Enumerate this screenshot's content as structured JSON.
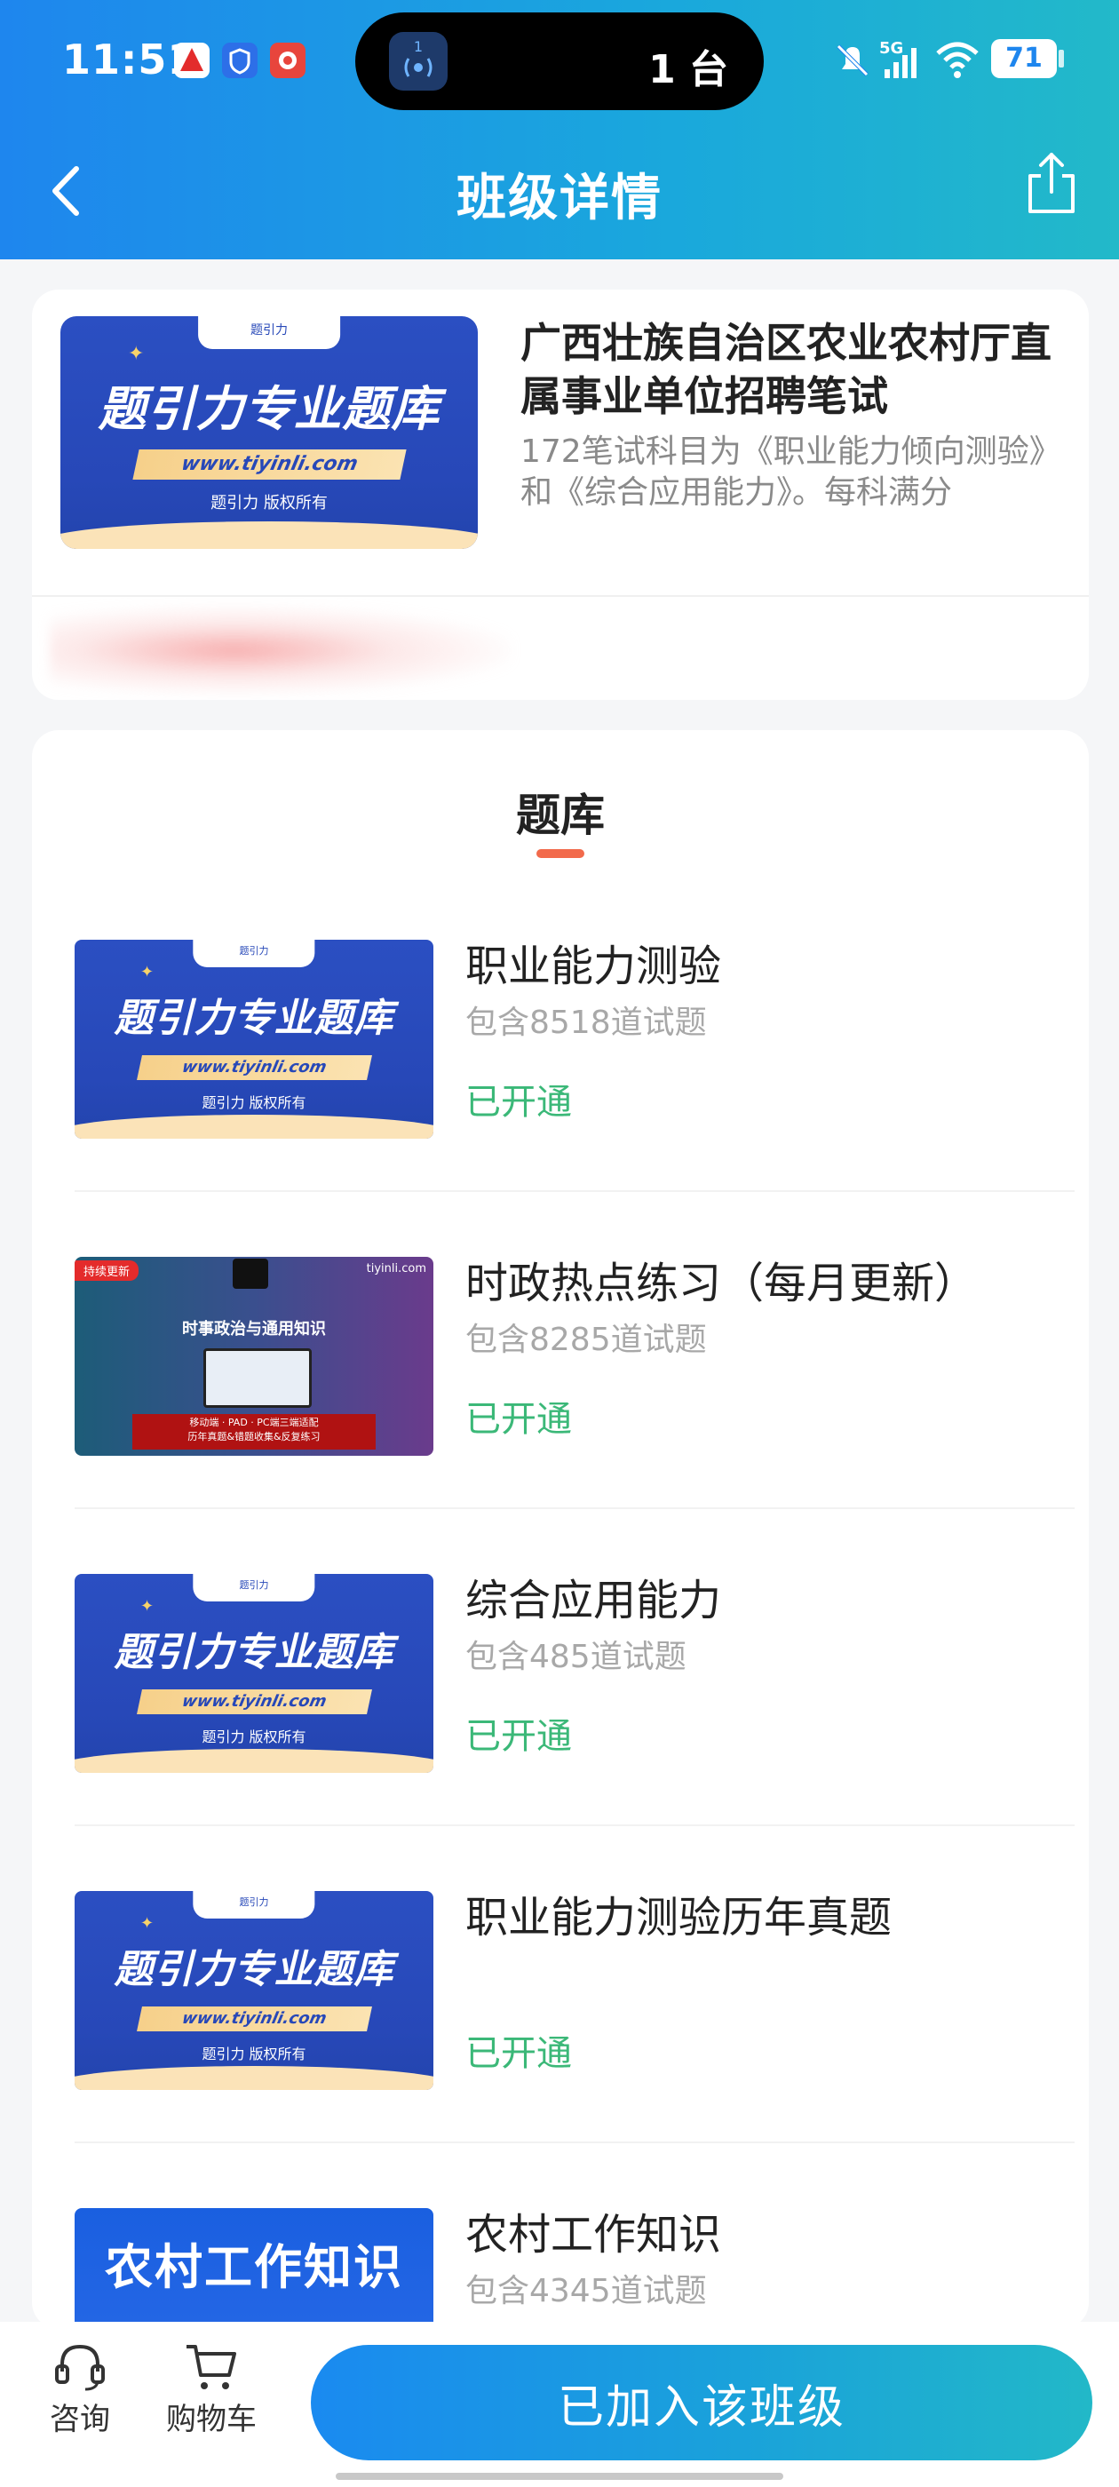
{
  "status_bar": {
    "time": "11:51",
    "island_icon_text": "1",
    "island_text": "1 台",
    "network": "5G",
    "battery": "71"
  },
  "nav": {
    "title": "班级详情"
  },
  "class_info": {
    "title": "广西壮族自治区农业农村厅直属事业单位招聘笔试",
    "description": "172笔试科目为《职业能力倾向测验》和《综合应用能力》。每科满分"
  },
  "bank_section": {
    "heading": "题库",
    "items": [
      {
        "name": "职业能力测验",
        "count": "包含8518道试题",
        "status": "已开通",
        "thumb": "blue"
      },
      {
        "name": "时政热点练习（每月更新）",
        "count": "包含8285道试题",
        "status": "已开通",
        "thumb": "dark"
      },
      {
        "name": "综合应用能力",
        "count": "包含485道试题",
        "status": "已开通",
        "thumb": "blue"
      },
      {
        "name": "职业能力测验历年真题",
        "count": "",
        "status": "已开通",
        "thumb": "blue"
      },
      {
        "name": "农村工作知识",
        "count": "包含4345道试题",
        "status": "",
        "thumb": "rural"
      }
    ]
  },
  "thumbnails": {
    "blue": {
      "tab": "题引力",
      "title": "题引力专业题库",
      "url": "www.tiyinli.com",
      "copyright": "题引力 版权所有"
    },
    "dark": {
      "badge": "持续更新",
      "domain": "tiyinli.com",
      "title": "时事政治与通用知识",
      "banner_line1": "移动端 · PAD · PC端三端适配",
      "banner_line2": "历年真题&错题收集&反复练习"
    },
    "rural": {
      "title": "农村工作知识"
    }
  },
  "bottom_bar": {
    "consult_label": "咨询",
    "cart_label": "购物车",
    "join_label": "已加入该班级"
  },
  "colors": {
    "header_start": "#1e86ee",
    "header_end": "#22b9c9",
    "status_green": "#3bb878",
    "accent_underline": "#f26a4b"
  }
}
